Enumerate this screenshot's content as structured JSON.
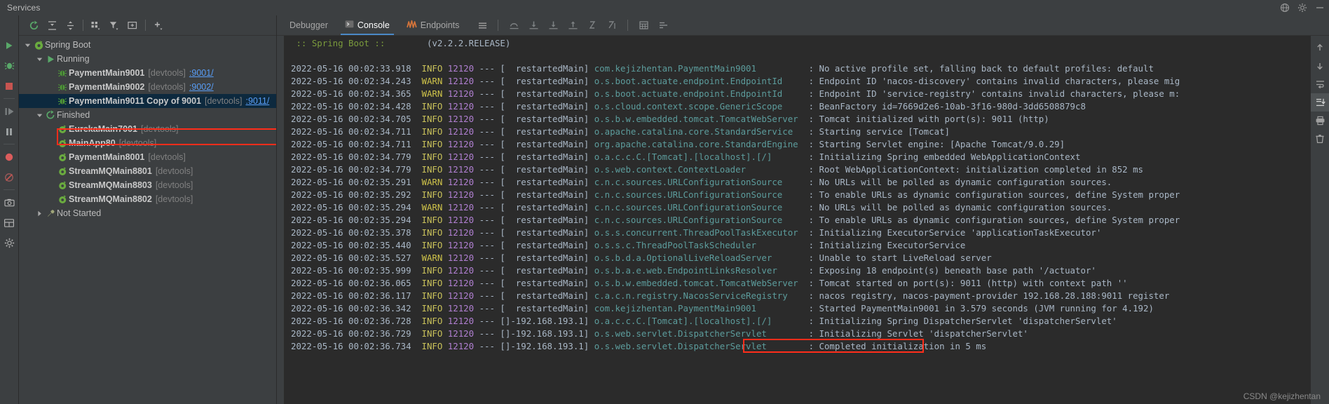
{
  "window": {
    "title": "Services",
    "controls": [
      "globe-icon",
      "gear-icon",
      "minimize-icon"
    ]
  },
  "tree_toolbar": {
    "buttons": [
      {
        "name": "rerun-icon",
        "label": "Rerun"
      },
      {
        "name": "expand-all-icon",
        "label": "Expand All"
      },
      {
        "name": "collapse-all-icon",
        "label": "Collapse All"
      },
      {
        "name": "group-by-icon",
        "label": "Group By"
      },
      {
        "name": "filter-icon",
        "label": "Filter"
      },
      {
        "name": "show-in-new-window-icon",
        "label": "Open in New Window"
      },
      {
        "name": "add-icon",
        "label": "Add Service"
      }
    ]
  },
  "rail": {
    "items": [
      {
        "name": "run-icon"
      },
      {
        "name": "debug-icon"
      },
      {
        "name": "stop-icon"
      },
      {
        "name": "resume-icon"
      },
      {
        "name": "pause-icon"
      },
      {
        "name": "breakpoint-icon"
      },
      {
        "name": "mute-breakpoints-icon"
      },
      {
        "name": "camera-icon"
      },
      {
        "name": "layout-icon"
      },
      {
        "name": "settings-icon"
      }
    ]
  },
  "tree": {
    "nodes": [
      {
        "depth": 0,
        "twist": "down",
        "icon": "spring-boot-icon",
        "label": "Spring Boot",
        "bold": false,
        "dev": "",
        "port": "",
        "selected": false
      },
      {
        "depth": 1,
        "twist": "down",
        "icon": "running-icon",
        "label": "Running",
        "bold": false,
        "dev": "",
        "port": "",
        "selected": false
      },
      {
        "depth": 2,
        "twist": "none",
        "icon": "spring-bean-icon",
        "label": "PaymentMain9001",
        "bold": true,
        "dev": "[devtools]",
        "port": ":9001/",
        "selected": false
      },
      {
        "depth": 2,
        "twist": "none",
        "icon": "spring-bean-icon",
        "label": "PaymentMain9002",
        "bold": true,
        "dev": "[devtools]",
        "port": ":9002/",
        "selected": false
      },
      {
        "depth": 2,
        "twist": "none",
        "icon": "spring-bean-icon",
        "label": "PaymentMain9011 Copy of 9001",
        "bold": true,
        "dev": "[devtools]",
        "port": ":9011/",
        "selected": true
      },
      {
        "depth": 1,
        "twist": "down",
        "icon": "finished-icon",
        "label": "Finished",
        "bold": false,
        "dev": "",
        "port": "",
        "selected": false
      },
      {
        "depth": 2,
        "twist": "none",
        "icon": "spring-leaf-icon",
        "label": "EurekaMain7001",
        "bold": true,
        "dev": "[devtools]",
        "port": "",
        "selected": false
      },
      {
        "depth": 2,
        "twist": "none",
        "icon": "spring-leaf-icon",
        "label": "MainApp80",
        "bold": true,
        "dev": "[devtools]",
        "port": "",
        "selected": false
      },
      {
        "depth": 2,
        "twist": "none",
        "icon": "spring-leaf-icon",
        "label": "PaymentMain8001",
        "bold": true,
        "dev": "[devtools]",
        "port": "",
        "selected": false
      },
      {
        "depth": 2,
        "twist": "none",
        "icon": "spring-leaf-icon",
        "label": "StreamMQMain8801",
        "bold": true,
        "dev": "[devtools]",
        "port": "",
        "selected": false
      },
      {
        "depth": 2,
        "twist": "none",
        "icon": "spring-leaf-icon",
        "label": "StreamMQMain8803",
        "bold": true,
        "dev": "[devtools]",
        "port": "",
        "selected": false
      },
      {
        "depth": 2,
        "twist": "none",
        "icon": "spring-leaf-icon",
        "label": "StreamMQMain8802",
        "bold": true,
        "dev": "[devtools]",
        "port": "",
        "selected": false
      },
      {
        "depth": 1,
        "twist": "right",
        "icon": "not-started-icon",
        "label": "Not Started",
        "bold": false,
        "dev": "",
        "port": "",
        "selected": false
      }
    ]
  },
  "tabs": [
    {
      "label": "Debugger",
      "icon": "",
      "active": false
    },
    {
      "label": "Console",
      "icon": "console-icon",
      "active": true
    },
    {
      "label": "Endpoints",
      "icon": "endpoints-icon",
      "active": false
    }
  ],
  "tab_toolbar": {
    "icons": [
      "menu-icon",
      "step-over-icon",
      "step-into-icon",
      "force-step-into-icon",
      "step-out-icon",
      "drop-frame-icon",
      "run-to-cursor-icon",
      "evaluate-icon",
      "settings-list-icon"
    ]
  },
  "console_toolbar": {
    "icons": [
      "scroll-up-icon",
      "scroll-down-icon",
      "soft-wrap-icon",
      "scroll-to-end-icon",
      "print-icon",
      "clear-all-icon"
    ]
  },
  "banner": {
    "text": ":: Spring Boot ::",
    "version": "(v2.2.2.RELEASE)"
  },
  "log": [
    {
      "ts": "2022-05-16 00:02:33.918",
      "level": "INFO",
      "pid": "12120",
      "thread": "restartedMain",
      "logger": "com.kejizhentan.PaymentMain9001",
      "msg": "No active profile set, falling back to default profiles: default"
    },
    {
      "ts": "2022-05-16 00:02:34.243",
      "level": "WARN",
      "pid": "12120",
      "thread": "restartedMain",
      "logger": "o.s.boot.actuate.endpoint.EndpointId",
      "msg": "Endpoint ID 'nacos-discovery' contains invalid characters, please mig"
    },
    {
      "ts": "2022-05-16 00:02:34.365",
      "level": "WARN",
      "pid": "12120",
      "thread": "restartedMain",
      "logger": "o.s.boot.actuate.endpoint.EndpointId",
      "msg": "Endpoint ID 'service-registry' contains invalid characters, please m:"
    },
    {
      "ts": "2022-05-16 00:02:34.428",
      "level": "INFO",
      "pid": "12120",
      "thread": "restartedMain",
      "logger": "o.s.cloud.context.scope.GenericScope",
      "msg": "BeanFactory id=7669d2e6-10ab-3f16-980d-3dd6508879c8"
    },
    {
      "ts": "2022-05-16 00:02:34.705",
      "level": "INFO",
      "pid": "12120",
      "thread": "restartedMain",
      "logger": "o.s.b.w.embedded.tomcat.TomcatWebServer",
      "msg": "Tomcat initialized with port(s): 9011 (http)"
    },
    {
      "ts": "2022-05-16 00:02:34.711",
      "level": "INFO",
      "pid": "12120",
      "thread": "restartedMain",
      "logger": "o.apache.catalina.core.StandardService",
      "msg": "Starting service [Tomcat]"
    },
    {
      "ts": "2022-05-16 00:02:34.711",
      "level": "INFO",
      "pid": "12120",
      "thread": "restartedMain",
      "logger": "org.apache.catalina.core.StandardEngine",
      "msg": "Starting Servlet engine: [Apache Tomcat/9.0.29]"
    },
    {
      "ts": "2022-05-16 00:02:34.779",
      "level": "INFO",
      "pid": "12120",
      "thread": "restartedMain",
      "logger": "o.a.c.c.C.[Tomcat].[localhost].[/]",
      "msg": "Initializing Spring embedded WebApplicationContext"
    },
    {
      "ts": "2022-05-16 00:02:34.779",
      "level": "INFO",
      "pid": "12120",
      "thread": "restartedMain",
      "logger": "o.s.web.context.ContextLoader",
      "msg": "Root WebApplicationContext: initialization completed in 852 ms"
    },
    {
      "ts": "2022-05-16 00:02:35.291",
      "level": "WARN",
      "pid": "12120",
      "thread": "restartedMain",
      "logger": "c.n.c.sources.URLConfigurationSource",
      "msg": "No URLs will be polled as dynamic configuration sources."
    },
    {
      "ts": "2022-05-16 00:02:35.292",
      "level": "INFO",
      "pid": "12120",
      "thread": "restartedMain",
      "logger": "c.n.c.sources.URLConfigurationSource",
      "msg": "To enable URLs as dynamic configuration sources, define System proper"
    },
    {
      "ts": "2022-05-16 00:02:35.294",
      "level": "WARN",
      "pid": "12120",
      "thread": "restartedMain",
      "logger": "c.n.c.sources.URLConfigurationSource",
      "msg": "No URLs will be polled as dynamic configuration sources."
    },
    {
      "ts": "2022-05-16 00:02:35.294",
      "level": "INFO",
      "pid": "12120",
      "thread": "restartedMain",
      "logger": "c.n.c.sources.URLConfigurationSource",
      "msg": "To enable URLs as dynamic configuration sources, define System proper"
    },
    {
      "ts": "2022-05-16 00:02:35.378",
      "level": "INFO",
      "pid": "12120",
      "thread": "restartedMain",
      "logger": "o.s.s.concurrent.ThreadPoolTaskExecutor",
      "msg": "Initializing ExecutorService 'applicationTaskExecutor'"
    },
    {
      "ts": "2022-05-16 00:02:35.440",
      "level": "INFO",
      "pid": "12120",
      "thread": "restartedMain",
      "logger": "o.s.s.c.ThreadPoolTaskScheduler",
      "msg": "Initializing ExecutorService"
    },
    {
      "ts": "2022-05-16 00:02:35.527",
      "level": "WARN",
      "pid": "12120",
      "thread": "restartedMain",
      "logger": "o.s.b.d.a.OptionalLiveReloadServer",
      "msg": "Unable to start LiveReload server"
    },
    {
      "ts": "2022-05-16 00:02:35.999",
      "level": "INFO",
      "pid": "12120",
      "thread": "restartedMain",
      "logger": "o.s.b.a.e.web.EndpointLinksResolver",
      "msg": "Exposing 18 endpoint(s) beneath base path '/actuator'"
    },
    {
      "ts": "2022-05-16 00:02:36.065",
      "level": "INFO",
      "pid": "12120",
      "thread": "restartedMain",
      "logger": "o.s.b.w.embedded.tomcat.TomcatWebServer",
      "msg": "Tomcat started on port(s): 9011 (http) with context path ''"
    },
    {
      "ts": "2022-05-16 00:02:36.117",
      "level": "INFO",
      "pid": "12120",
      "thread": "restartedMain",
      "logger": "c.a.c.n.registry.NacosServiceRegistry",
      "msg": "nacos registry, nacos-payment-provider 192.168.28.188:9011 register "
    },
    {
      "ts": "2022-05-16 00:02:36.342",
      "level": "INFO",
      "pid": "12120",
      "thread": "restartedMain",
      "logger": "com.kejizhentan.PaymentMain9001",
      "msg": "Started PaymentMain9001 in 3.579 seconds (JVM running for 4.192)"
    },
    {
      "ts": "2022-05-16 00:02:36.728",
      "level": "INFO",
      "pid": "12120",
      "thread": "]-192.168.193.1",
      "logger": "o.a.c.c.C.[Tomcat].[localhost].[/]",
      "msg": "Initializing Spring DispatcherServlet 'dispatcherServlet'"
    },
    {
      "ts": "2022-05-16 00:02:36.729",
      "level": "INFO",
      "pid": "12120",
      "thread": "]-192.168.193.1",
      "logger": "o.s.web.servlet.DispatcherServlet",
      "msg": "Initializing Servlet 'dispatcherServlet'"
    },
    {
      "ts": "2022-05-16 00:02:36.734",
      "level": "INFO",
      "pid": "12120",
      "thread": "]-192.168.193.1",
      "logger": "o.s.web.servlet.DispatcherServlet",
      "msg": "Completed initialization in 5 ms"
    }
  ],
  "watermark": "CSDN @kejizhentan",
  "colors": {
    "accent": "#589df6",
    "highlight_box": "#ff2d1a",
    "selection": "#0d293e",
    "console_bg": "#2b2b2b",
    "panel_bg": "#3c3f41",
    "info": "#c9c15a",
    "warn": "#cfc34a",
    "logger": "#5c9c9c",
    "pid": "#b07fd1"
  }
}
